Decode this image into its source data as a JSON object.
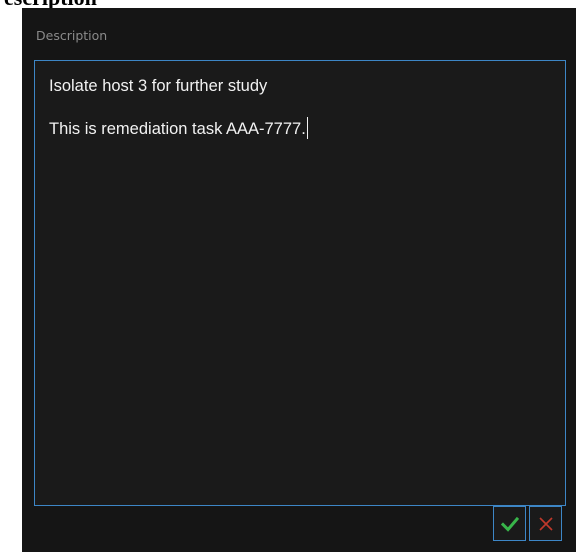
{
  "header": {
    "title": "Description"
  },
  "description_field": {
    "line1": "Isolate host 3 for further study",
    "line2": "This is remediation task AAA-7777."
  },
  "actions": {
    "confirm_icon": "checkmark-icon",
    "cancel_icon": "close-icon"
  },
  "colors": {
    "panel_background": "#151515",
    "border": "#3d86c6",
    "confirm": "#38b54a",
    "cancel": "#c0392b"
  }
}
